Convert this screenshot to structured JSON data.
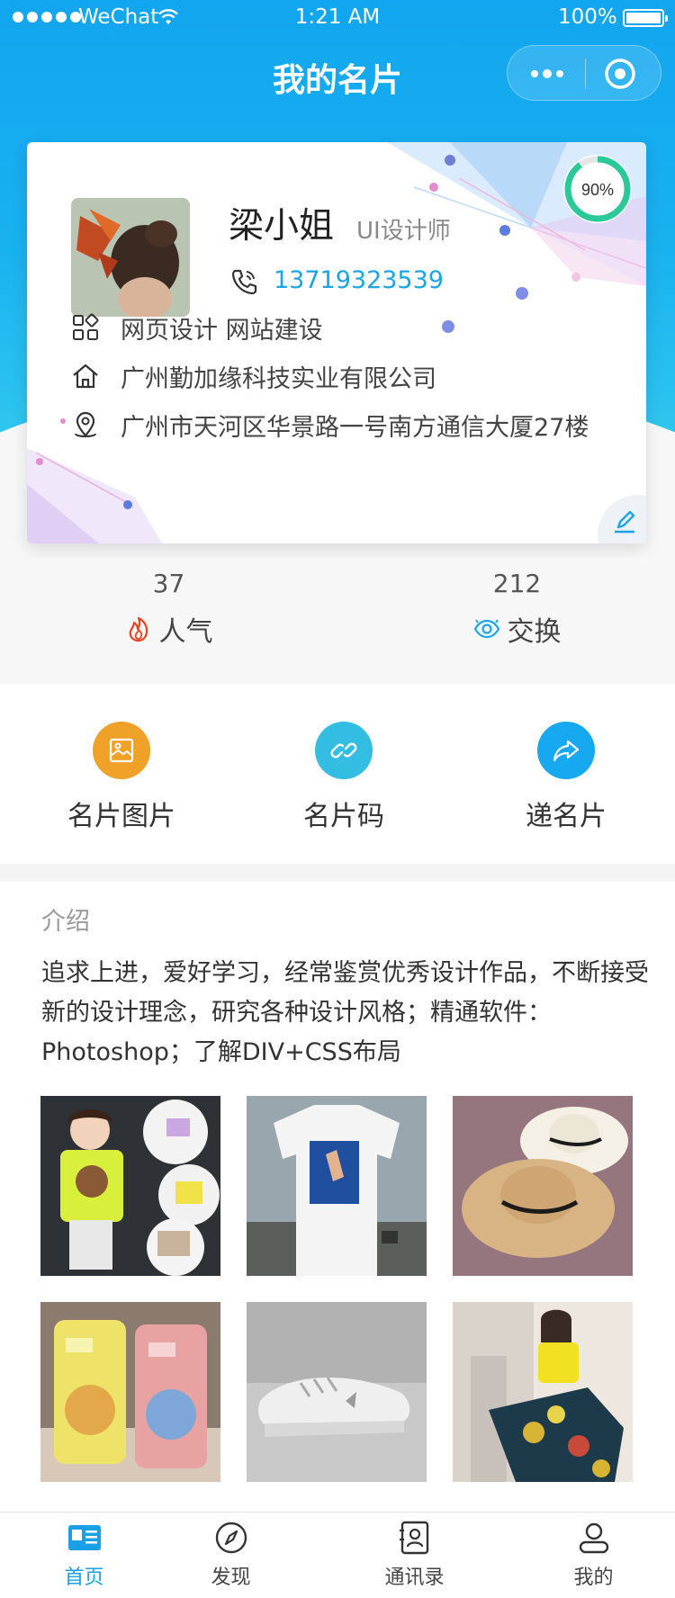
{
  "status_bar": {
    "carrier": "WeChat",
    "time": "1:21 AM",
    "battery": "100%"
  },
  "nav": {
    "title": "我的名片"
  },
  "card": {
    "name": "梁小姐",
    "job_title": "UI设计师",
    "phone": "13719323539",
    "completion": "90%",
    "services": "网页设计 网站建设",
    "company": "广州勤加缘科技实业有限公司",
    "address": "广州市天河区华景路一号南方通信大厦27楼"
  },
  "stats": {
    "popularity": {
      "value": "37",
      "label": "人气"
    },
    "exchange": {
      "value": "212",
      "label": "交换"
    }
  },
  "actions": [
    {
      "label": "名片图片",
      "color": "#f0a127"
    },
    {
      "label": "名片码",
      "color": "#33bde3"
    },
    {
      "label": "递名片",
      "color": "#17a9ef"
    }
  ],
  "intro": {
    "label": "介绍",
    "text": "追求上进，爱好学习，经常鉴赏优秀设计作品，不断接受新的设计理念，研究各种设计风格；精通软件：Photoshop；了解DIV+CSS布局"
  },
  "tabbar": [
    {
      "label": "首页",
      "icon": "home-card-icon",
      "active": true
    },
    {
      "label": "发现",
      "icon": "compass-icon",
      "active": false
    },
    {
      "label": "通讯录",
      "icon": "contacts-icon",
      "active": false
    },
    {
      "label": "我的",
      "icon": "user-icon",
      "active": false
    }
  ],
  "colors": {
    "brand": "#1aa5e8",
    "accent_orange": "#f0a127"
  }
}
